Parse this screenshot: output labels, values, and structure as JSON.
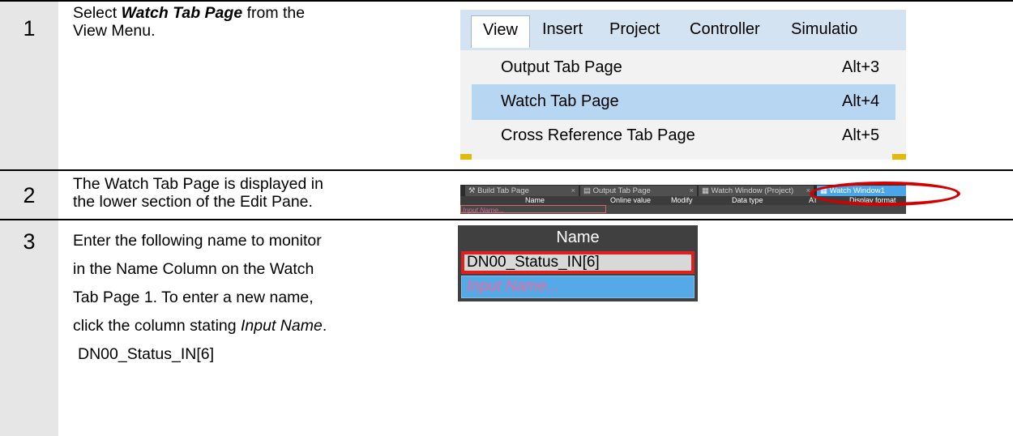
{
  "steps": [
    {
      "number": "1",
      "text_before": "Select ",
      "text_bold": "Watch Tab Page",
      "text_after": " from the",
      "line2": "View Menu."
    },
    {
      "number": "2",
      "line1": "The Watch Tab Page is displayed in",
      "line2": "the lower section of the Edit Pane."
    },
    {
      "number": "3",
      "line1": "Enter the following name to monitor",
      "line2": "in the Name Column on the Watch",
      "line3": "Tab Page 1. To enter a new name,",
      "line4_before": "click the column stating ",
      "line4_italic": "Input Name",
      "line4_after": ".",
      "value": "DN00_Status_IN[6]"
    }
  ],
  "menu": {
    "bar": [
      "View",
      "Insert",
      "Project",
      "Controller",
      "Simulatio"
    ],
    "items": [
      {
        "label": "Output Tab Page",
        "shortcut": "Alt+3"
      },
      {
        "label": "Watch Tab Page",
        "shortcut": "Alt+4"
      },
      {
        "label": "Cross Reference Tab Page",
        "shortcut": "Alt+5"
      }
    ]
  },
  "tabs": {
    "items": [
      "Build Tab Page",
      "Output Tab Page",
      "Watch Window (Project)",
      "Watch Window1"
    ],
    "close_glyph": "×",
    "columns": [
      "Name",
      "Online value",
      "Modify",
      "Data type",
      "AT",
      "Display format"
    ],
    "input_placeholder": "Input Name..."
  },
  "name_panel": {
    "header": "Name",
    "value": "DN00_Status_IN[6]",
    "placeholder": "Input Name..."
  },
  "colors": {
    "step_column": "#e6e6e6",
    "highlight": "#b7d6f2",
    "red_mark": "#d40000"
  }
}
